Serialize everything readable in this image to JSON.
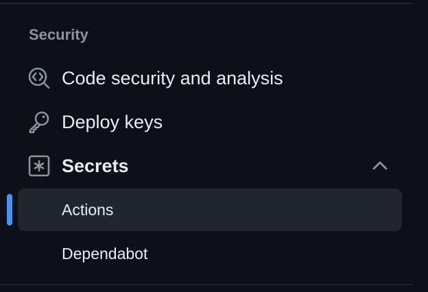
{
  "section": {
    "heading": "Security"
  },
  "items": [
    {
      "label": "Code security and analysis",
      "icon": "codescan-icon"
    },
    {
      "label": "Deploy keys",
      "icon": "key-icon"
    },
    {
      "label": "Secrets",
      "icon": "asterisk-box-icon",
      "expanded": true
    }
  ],
  "secrets_subitems": [
    {
      "label": "Actions",
      "active": true
    },
    {
      "label": "Dependabot",
      "active": false
    }
  ],
  "colors": {
    "background": "#0d1117",
    "text": "#e6edf3",
    "muted": "#8b949e",
    "active_bg": "#21262d",
    "accent": "#4493f8"
  }
}
